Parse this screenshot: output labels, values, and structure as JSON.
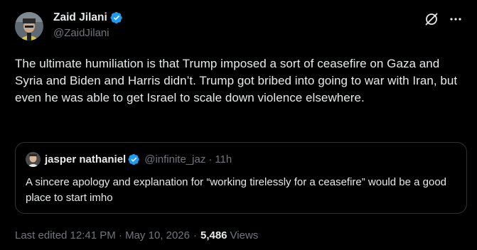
{
  "author": {
    "display_name": "Zaid Jilani",
    "handle": "@ZaidJilani",
    "verified": true
  },
  "tweet": {
    "text": "The ultimate humiliation is that Trump imposed a sort of ceasefire on Gaza and Syria and Biden and Harris didn’t. Trump got bribed into going to war with Iran, but even he was able to get Israel to scale down violence elsewhere."
  },
  "quote": {
    "display_name": "jasper nathaniel",
    "handle": "@infinite_jaz",
    "separator": "·",
    "time": "11h",
    "text": "A sincere apology and explanation for “working tirelessly for a ceasefire” would be a good place to start imho"
  },
  "meta": {
    "edited": "Last edited 12:41 PM · May 10, 2026",
    "separator": "·",
    "views_count": "5,486",
    "views_label": "Views"
  },
  "icons": {
    "header": [
      "grok-icon",
      "more-icon"
    ],
    "verified": "verified-badge-icon"
  },
  "colors": {
    "background": "#000000",
    "text": "#e7e9ea",
    "secondary": "#71767b",
    "border": "#2f3336",
    "verified": "#1d9bf0"
  }
}
